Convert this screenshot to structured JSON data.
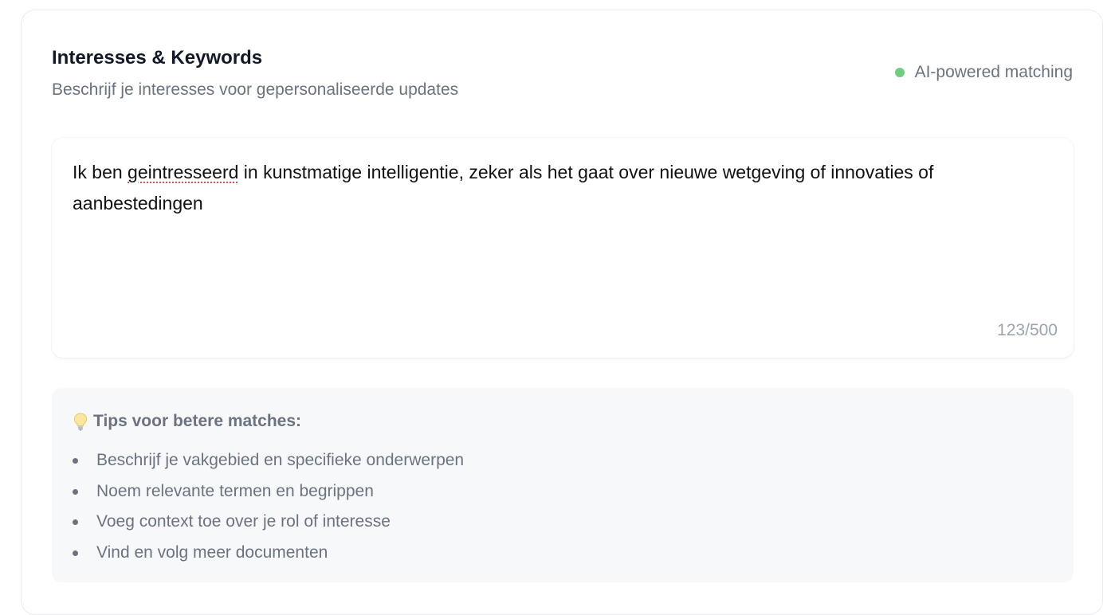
{
  "header": {
    "title": "Interesses & Keywords",
    "subtitle": "Beschrijf je interesses voor gepersonaliseerde updates",
    "badge_label": "AI-powered matching",
    "badge_color": "#6fcf7f"
  },
  "interests_input": {
    "value_before": "Ik ben ",
    "misspelled_word": "geintresseerd",
    "value_after": " in kunstmatige intelligentie, zeker als het gaat over nieuwe wetgeving of innovaties of aanbestedingen",
    "char_count": "123/500"
  },
  "tips": {
    "icon": "lightbulb-icon",
    "title": "Tips voor betere matches:",
    "items": [
      {
        "label": "Beschrijf je vakgebied en specifieke onderwerpen"
      },
      {
        "label": "Noem relevante termen en begrippen"
      },
      {
        "label": "Voeg context toe over je rol of interesse"
      },
      {
        "label": "Vind en volg meer documenten"
      }
    ]
  }
}
